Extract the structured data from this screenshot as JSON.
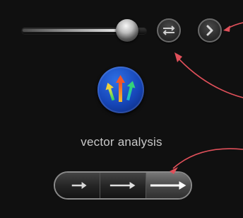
{
  "slider": {
    "value_fraction": 0.88
  },
  "buttons": {
    "swap": {
      "icon": "swap-arrows-icon"
    },
    "next": {
      "icon": "chevron-right-icon"
    }
  },
  "app": {
    "icon": "vector-analysis-arrows-icon",
    "label": "vector analysis"
  },
  "segmented_control": {
    "segments": [
      {
        "icon": "arrow-short-icon",
        "active": false
      },
      {
        "icon": "arrow-medium-icon",
        "active": false
      },
      {
        "icon": "arrow-long-icon",
        "active": true
      }
    ]
  },
  "colors": {
    "background": "#101010",
    "app_icon_blue": "#1646b8",
    "annotation_red": "#e0505a",
    "label_gray": "#c9c9c9"
  }
}
